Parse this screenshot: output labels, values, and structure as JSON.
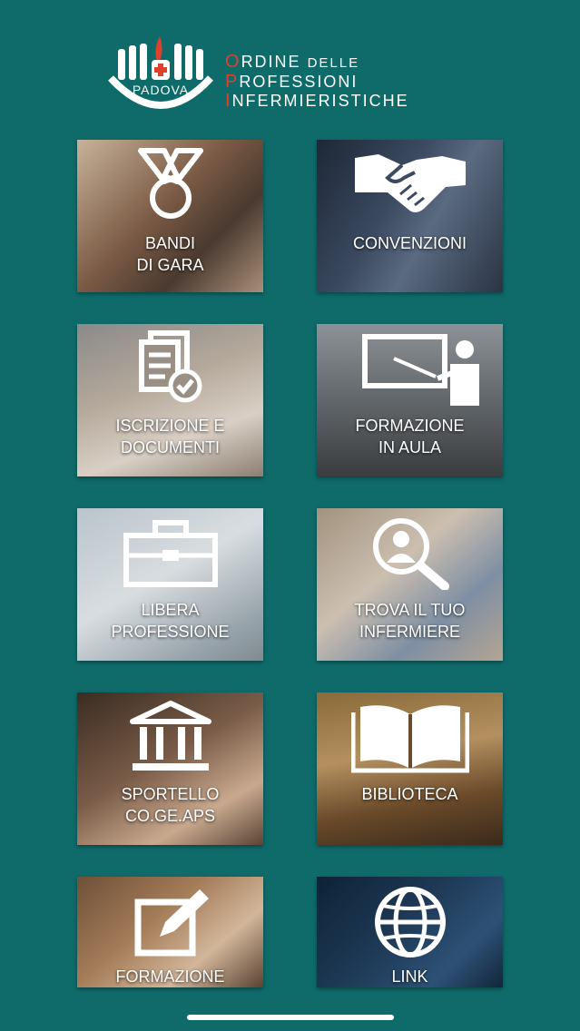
{
  "header": {
    "logo_city": "PADOVA",
    "line1_initial": "O",
    "line1_rest": "RDINE",
    "line1_small": "DELLE",
    "line2_initial": "P",
    "line2_rest": "ROFESSIONI",
    "line3_initial": "I",
    "line3_rest": "NFERMIERISTICHE"
  },
  "tiles": [
    {
      "line1": "BANDI",
      "line2": "DI GARA",
      "icon": "medal-icon"
    },
    {
      "line1": "CONVENZIONI",
      "line2": "",
      "icon": "handshake-icon"
    },
    {
      "line1": "ISCRIZIONE E",
      "line2": "DOCUMENTI",
      "icon": "documents-check-icon"
    },
    {
      "line1": "FORMAZIONE",
      "line2": "IN AULA",
      "icon": "teacher-board-icon"
    },
    {
      "line1": "LIBERA",
      "line2": "PROFESSIONE",
      "icon": "briefcase-icon"
    },
    {
      "line1": "TROVA IL TUO",
      "line2": "INFERMIERE",
      "icon": "search-person-icon"
    },
    {
      "line1": "SPORTELLO",
      "line2": "CO.GE.APS",
      "icon": "bank-icon"
    },
    {
      "line1": "BIBLIOTECA",
      "line2": "",
      "icon": "book-icon"
    },
    {
      "line1": "FORMAZIONE",
      "line2": "",
      "icon": "edit-icon"
    },
    {
      "line1": "LINK",
      "line2": "",
      "icon": "globe-icon"
    }
  ],
  "colors": {
    "background": "#0f6a6a",
    "brand_accent": "#e0412b"
  }
}
